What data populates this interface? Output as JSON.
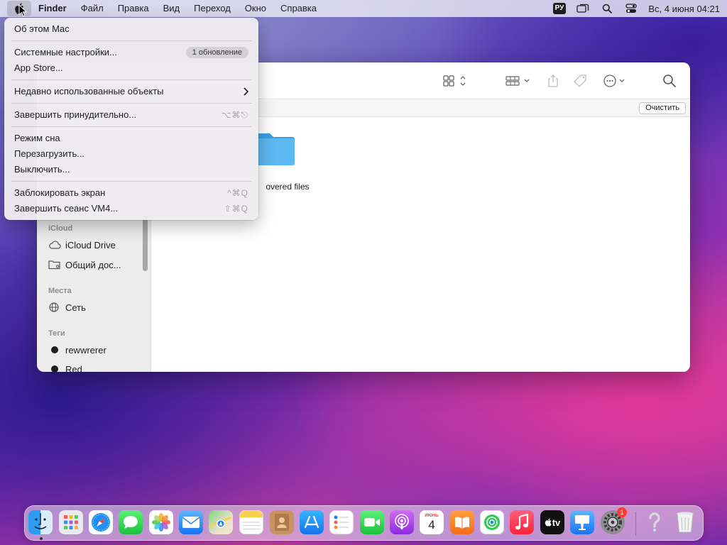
{
  "menubar": {
    "items": [
      "Finder",
      "Файл",
      "Правка",
      "Вид",
      "Переход",
      "Окно",
      "Справка"
    ],
    "keyboard_layout": "РУ",
    "clock": "Вс, 4 июня  04:21",
    "icons": [
      "apple-icon",
      "screen-mirror-icon",
      "search-icon",
      "control-center-icon"
    ]
  },
  "apple_menu": {
    "about": "Об этом Mac",
    "settings": "Системные настройки...",
    "settings_badge": "1 обновление",
    "app_store": "App Store...",
    "recent": "Недавно использованные объекты",
    "force_quit": "Завершить принудительно...",
    "force_quit_shortcut": "⌥⌘⎋",
    "sleep": "Режим сна",
    "restart": "Перезагрузить...",
    "shutdown": "Выключить...",
    "lock": "Заблокировать экран",
    "lock_shortcut": "^⌘Q",
    "logout": "Завершить сеанс VM4...",
    "logout_shortcut": "⇧⌘Q"
  },
  "finder": {
    "clear_button": "Очистить",
    "folder_name": "overed files",
    "sidebar": {
      "icloud_header": "iCloud",
      "icloud_drive": "iCloud Drive",
      "shared": "Общий дос...",
      "places_header": "Места",
      "network": "Сеть",
      "tags_header": "Теги",
      "tags": [
        "rewwrerer",
        "Red"
      ]
    }
  },
  "dock": {
    "apps": [
      "Finder",
      "Launchpad",
      "Safari",
      "Messages",
      "Photos",
      "Mail",
      "Maps",
      "Notes",
      "Contacts",
      "App Store",
      "Reminders",
      "FaceTime",
      "Podcasts",
      "Calendar",
      "Books",
      "Find My",
      "Music",
      "TV",
      "Keynote",
      "System Preferences",
      "Help",
      "Trash"
    ],
    "calendar_month": "ИЮНЬ",
    "calendar_day": "4",
    "tv_label": "tv",
    "settings_badge": "1"
  },
  "colors": {
    "accent_blue": "#1d8bf5",
    "folder_blue": "#5eb8f2"
  }
}
